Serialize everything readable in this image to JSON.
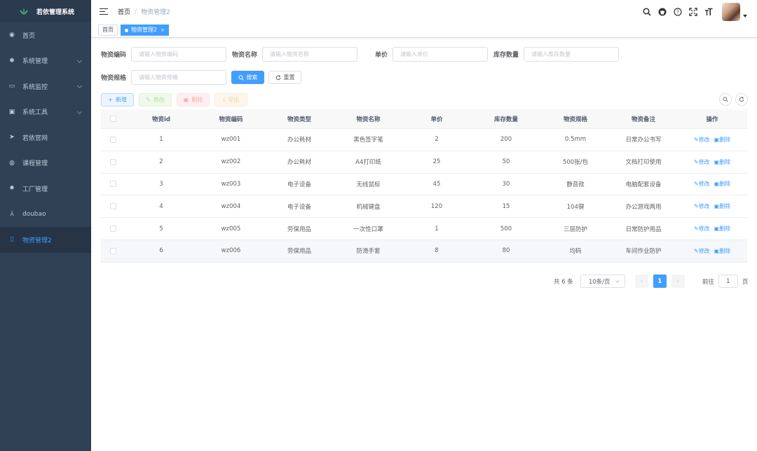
{
  "app": {
    "title": "若依管理系统"
  },
  "sidebar": {
    "items": [
      {
        "label": "首页",
        "icon": "dashboard-icon",
        "glyph": "◉",
        "has_children": false,
        "active": false
      },
      {
        "label": "系统管理",
        "icon": "settings-icon",
        "glyph": "✱",
        "has_children": true,
        "active": false
      },
      {
        "label": "系统监控",
        "icon": "monitor-icon",
        "glyph": "▭",
        "has_children": true,
        "active": false
      },
      {
        "label": "系统工具",
        "icon": "toolbox-icon",
        "glyph": "▣",
        "has_children": true,
        "active": false
      },
      {
        "label": "若依官网",
        "icon": "send-icon",
        "glyph": "➤",
        "has_children": false,
        "active": false
      },
      {
        "label": "课程管理",
        "icon": "course-icon",
        "glyph": "◍",
        "has_children": false,
        "active": false
      },
      {
        "label": "工厂管理",
        "icon": "bug-icon",
        "glyph": "✸",
        "has_children": false,
        "active": false
      },
      {
        "label": "doubao",
        "icon": "tree-icon",
        "glyph": "⅄",
        "has_children": false,
        "active": false
      },
      {
        "label": "物资管理2",
        "icon": "document-icon",
        "glyph": "▯",
        "has_children": false,
        "active": true
      }
    ]
  },
  "navbar": {
    "breadcrumb": [
      "首页",
      "物资管理2"
    ],
    "icons": [
      "search-icon",
      "github-icon",
      "help-icon",
      "fullscreen-icon",
      "font-size-icon"
    ]
  },
  "tags": [
    {
      "label": "首页",
      "active": false
    },
    {
      "label": "物资管理2",
      "active": true,
      "close": "×"
    }
  ],
  "search": {
    "code": {
      "label": "物资编码",
      "placeholder": "请输入物资编码",
      "value": ""
    },
    "name": {
      "label": "物资名称",
      "placeholder": "请输入物资名称",
      "value": ""
    },
    "price": {
      "label": "单价",
      "placeholder": "请输入单价",
      "value": ""
    },
    "stock": {
      "label": "库存数量",
      "placeholder": "请输入库存数量",
      "value": ""
    },
    "spec": {
      "label": "物资规格",
      "placeholder": "请输入物资规格",
      "value": ""
    },
    "search_button": "搜索",
    "reset_button": "重置"
  },
  "toolbar": {
    "add": "新增",
    "edit": "修改",
    "delete": "删除",
    "export": "导出"
  },
  "table": {
    "columns": [
      "物资id",
      "物资编码",
      "物资类型",
      "物资名称",
      "单价",
      "库存数量",
      "物资规格",
      "物资备注",
      "操作"
    ],
    "edit_label": "修改",
    "delete_label": "删除",
    "rows": [
      {
        "id": "1",
        "code": "wz001",
        "type": "办公耗材",
        "name": "黑色签字笔",
        "price": "2",
        "stock": "200",
        "spec": "0.5mm",
        "note": "日常办公书写"
      },
      {
        "id": "2",
        "code": "wz002",
        "type": "办公耗材",
        "name": "A4打印纸",
        "price": "25",
        "stock": "50",
        "spec": "500张/包",
        "note": "文档打印使用"
      },
      {
        "id": "3",
        "code": "wz003",
        "type": "电子设备",
        "name": "无线鼠标",
        "price": "45",
        "stock": "30",
        "spec": "静音款",
        "note": "电脑配套设备"
      },
      {
        "id": "4",
        "code": "wz004",
        "type": "电子设备",
        "name": "机械键盘",
        "price": "120",
        "stock": "15",
        "spec": "104键",
        "note": "办公游戏两用"
      },
      {
        "id": "5",
        "code": "wz005",
        "type": "劳保用品",
        "name": "一次性口罩",
        "price": "1",
        "stock": "500",
        "spec": "三层防护",
        "note": "日常防护用品"
      },
      {
        "id": "6",
        "code": "wz006",
        "type": "劳保用品",
        "name": "防滑手套",
        "price": "8",
        "stock": "80",
        "spec": "均码",
        "note": "车间作业防护"
      }
    ]
  },
  "pagination": {
    "total": "共 6 条",
    "page_size": "10条/页",
    "current_page": "1",
    "goto_label": "前往",
    "goto_value": "1",
    "page_unit": "页"
  },
  "colors": {
    "primary": "#409eff",
    "sidebar_bg": "#304156",
    "sidebar_active_text": "#409eff"
  }
}
